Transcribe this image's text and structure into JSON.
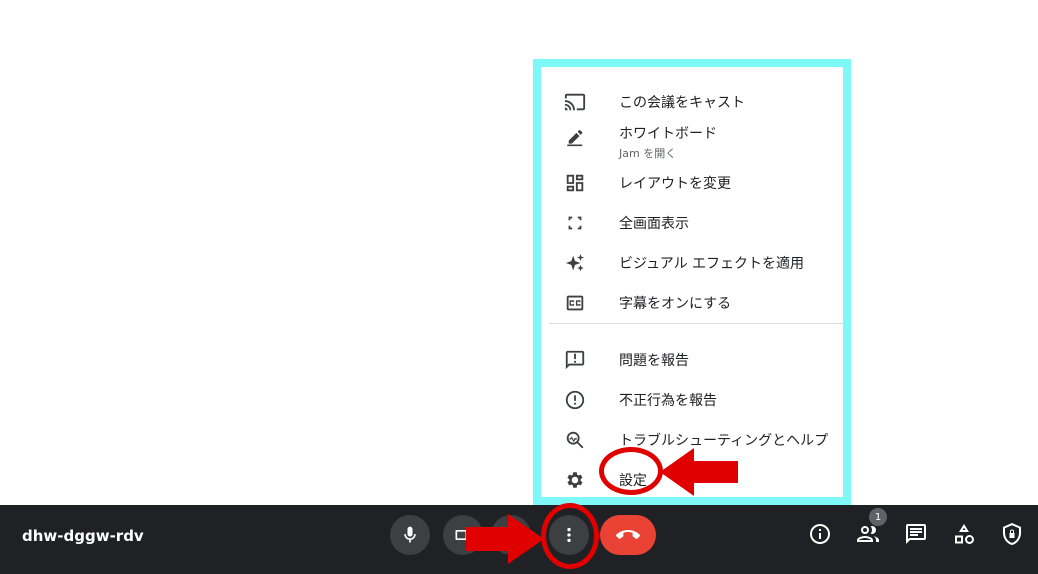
{
  "menu": {
    "items": [
      {
        "label": "この会議をキャスト",
        "icon": "cast-icon"
      },
      {
        "label": "ホワイトボード",
        "sublabel": "Jam を開く",
        "icon": "pencil-icon"
      },
      {
        "label": "レイアウトを変更",
        "icon": "layout-icon"
      },
      {
        "label": "全画面表示",
        "icon": "fullscreen-icon"
      },
      {
        "label": "ビジュアル エフェクトを適用",
        "icon": "sparkle-icon"
      },
      {
        "label": "字幕をオンにする",
        "icon": "closed-captions-icon"
      },
      {
        "label": "問題を報告",
        "icon": "feedback-icon"
      },
      {
        "label": "不正行為を報告",
        "icon": "report-abuse-icon"
      },
      {
        "label": "トラブルシューティングとヘルプ",
        "icon": "troubleshoot-icon"
      },
      {
        "label": "設定",
        "icon": "gear-icon"
      }
    ]
  },
  "bottombar": {
    "meeting_code": "dhw-dggw-rdv",
    "participants_count": "1"
  },
  "colors": {
    "highlight_frame": "#7ff9f7",
    "annotation_red": "#e00000",
    "bar_bg": "#202124",
    "hangup_red": "#ea4335"
  }
}
